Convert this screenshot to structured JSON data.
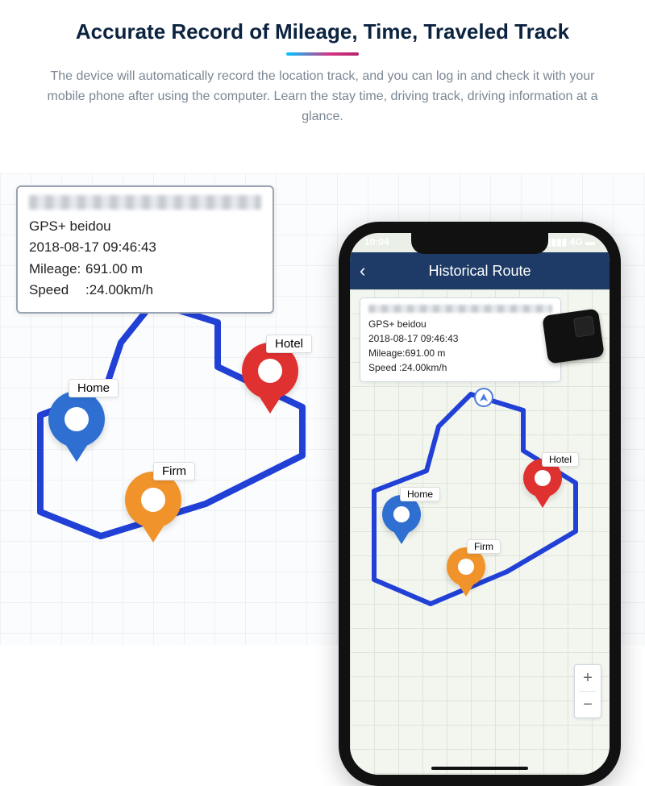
{
  "header": {
    "title": "Accurate Record of Mileage, Time, Traveled Track",
    "description": "The device will automatically record the location track, and you can log in and check it with your mobile phone after using the computer. Learn the stay time, driving track, driving information at a glance."
  },
  "info_card": {
    "source_label": "GPS+ beidou",
    "timestamp": "2018-08-17 09:46:43",
    "mileage_label": "Mileage:",
    "mileage_value": "691.00 m",
    "speed_label": "Speed",
    "speed_value": ":24.00km/h"
  },
  "bg_pins": {
    "home": {
      "label": "Home",
      "color": "#2f6fd1"
    },
    "firm": {
      "label": "Firm",
      "color": "#f0932b"
    },
    "hotel": {
      "label": "Hotel",
      "color": "#e03131"
    }
  },
  "phone": {
    "status_time": "10:04",
    "status_right": "4G",
    "screen_title": "Historical Route",
    "pins": {
      "home": {
        "label": "Home",
        "color": "#2f6fd1"
      },
      "firm": {
        "label": "Firm",
        "color": "#f0932b"
      },
      "hotel": {
        "label": "Hotel",
        "color": "#e03131"
      }
    },
    "zoom": {
      "in": "+",
      "out": "−"
    }
  }
}
